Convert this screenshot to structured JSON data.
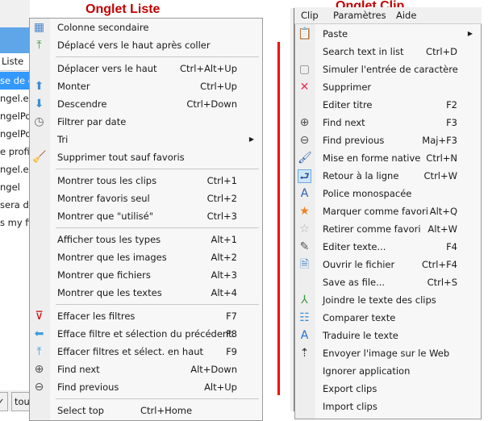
{
  "titles": {
    "liste": "Onglet Liste",
    "clip": "Onglet Clip"
  },
  "accent": "#c00000",
  "background": {
    "tab": "Liste",
    "rows": [
      "se de do",
      "ngel.ex",
      "ngelPo",
      "ngelPo",
      "e profi",
      "ngel.ex",
      "ngel",
      "sera de",
      "s my fi"
    ],
    "buttons": [
      "✓",
      "tou"
    ]
  },
  "menubar": [
    "Clip",
    "Paramètres",
    "Aide"
  ],
  "liste_menu": [
    {
      "label": "Colonne secondaire",
      "shortcut": "",
      "icon": "table-icon"
    },
    {
      "label": "Déplacé vers le haut après coller",
      "shortcut": "",
      "icon": "move-top-icon"
    },
    {
      "sep": true
    },
    {
      "label": "Déplacer vers le haut",
      "shortcut": "Ctrl+Alt+Up",
      "icon": ""
    },
    {
      "label": "Monter",
      "shortcut": "Ctrl+Up",
      "icon": "arrow-up-icon"
    },
    {
      "label": "Descendre",
      "shortcut": "Ctrl+Down",
      "icon": "arrow-down-icon"
    },
    {
      "label": "Filtrer par date",
      "shortcut": "",
      "icon": "calendar-clock-icon"
    },
    {
      "label": "Tri",
      "shortcut": "",
      "icon": "",
      "submenu": true
    },
    {
      "label": "Supprimer tout sauf favoris",
      "shortcut": "",
      "icon": "broom-icon"
    },
    {
      "sep": true
    },
    {
      "label": "Montrer tous les clips",
      "shortcut": "Ctrl+1",
      "icon": ""
    },
    {
      "label": "Montrer favoris seul",
      "shortcut": "Ctrl+2",
      "icon": ""
    },
    {
      "label": "Montrer que \"utilisé\"",
      "shortcut": "Ctrl+3",
      "icon": ""
    },
    {
      "sep": true
    },
    {
      "label": "Afficher tous les types",
      "shortcut": "Alt+1",
      "icon": ""
    },
    {
      "label": "Montrer que les images",
      "shortcut": "Alt+2",
      "icon": ""
    },
    {
      "label": "Montrer que fichiers",
      "shortcut": "Alt+3",
      "icon": ""
    },
    {
      "label": "Montrer que les textes",
      "shortcut": "Alt+4",
      "icon": ""
    },
    {
      "sep": true
    },
    {
      "label": "Effacer les filtres",
      "shortcut": "F7",
      "icon": "filter-clear-icon"
    },
    {
      "label": "Efface filtre et sélection du précédent.",
      "shortcut": "F8",
      "icon": "arrow-left-icon"
    },
    {
      "label": "Effacer filtres et sélect. en haut",
      "shortcut": "F9",
      "icon": "arrow-top-icon"
    },
    {
      "label": "Find next",
      "shortcut": "Alt+Down",
      "icon": "find-next-icon"
    },
    {
      "label": "Find previous",
      "shortcut": "Alt+Up",
      "icon": "find-previous-icon"
    },
    {
      "sep": true
    },
    {
      "label": "Select top",
      "shortcut": "Ctrl+Home",
      "icon": "",
      "shortcut_inline": true
    }
  ],
  "clip_menu": [
    {
      "label": "Paste",
      "shortcut": "",
      "icon": "clipboard-icon",
      "submenu": true
    },
    {
      "label": "Search text in list",
      "shortcut": "Ctrl+D",
      "icon": ""
    },
    {
      "label": "Simuler l'entrée de caractère",
      "shortcut": "",
      "icon": "key-icon"
    },
    {
      "label": "Supprimer",
      "shortcut": "",
      "icon": "delete-icon"
    },
    {
      "label": "Editer titre",
      "shortcut": "F2",
      "icon": ""
    },
    {
      "label": "Find next",
      "shortcut": "F3",
      "icon": "find-next-icon"
    },
    {
      "label": "Find previous",
      "shortcut": "Maj+F3",
      "icon": "find-previous-icon"
    },
    {
      "label": "Mise en forme native",
      "shortcut": "Ctrl+N",
      "icon": "brush-icon"
    },
    {
      "label": "Retour à la ligne",
      "shortcut": "Ctrl+W",
      "icon": "word-wrap-icon",
      "checked": true
    },
    {
      "label": "Police monospacée",
      "shortcut": "",
      "icon": "font-icon"
    },
    {
      "label": "Marquer comme favori",
      "shortcut": "Alt+Q",
      "icon": "star-icon"
    },
    {
      "label": "Retirer comme favori",
      "shortcut": "Alt+W",
      "icon": "star-outline-icon"
    },
    {
      "label": "Editer texte...",
      "shortcut": "F4",
      "icon": "pencil-icon"
    },
    {
      "label": "Ouvrir le fichier",
      "shortcut": "Ctrl+F4",
      "icon": "document-edit-icon"
    },
    {
      "label": "Save as file...",
      "shortcut": "Ctrl+S",
      "icon": ""
    },
    {
      "label": "Joindre le texte des clips",
      "shortcut": "",
      "icon": "merge-icon"
    },
    {
      "label": "Comparer texte",
      "shortcut": "",
      "icon": "compare-icon"
    },
    {
      "label": "Traduire le texte",
      "shortcut": "",
      "icon": "translate-icon"
    },
    {
      "label": "Envoyer l'image sur le Web",
      "shortcut": "",
      "icon": "cloud-upload-icon"
    },
    {
      "label": "Ignorer application",
      "shortcut": "",
      "icon": ""
    },
    {
      "label": "Export clips",
      "shortcut": "",
      "icon": ""
    },
    {
      "label": "Import clips",
      "shortcut": "",
      "icon": ""
    }
  ]
}
